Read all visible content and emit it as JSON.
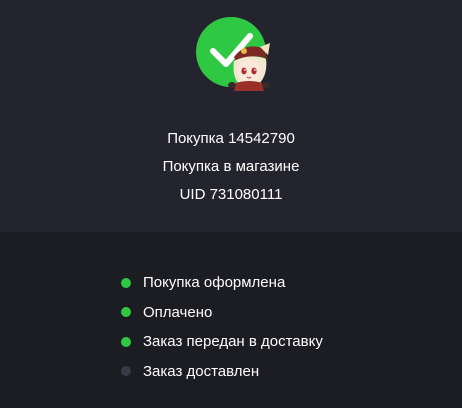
{
  "order": {
    "purchase_line": "Покупка 14542790",
    "type_line": "Покупка в магазине",
    "uid_line": "UID 731080111"
  },
  "colors": {
    "success_green": "#2fc843",
    "inactive_dot": "#3a3a46",
    "panel_top": "#24242e",
    "panel_bottom": "#1c1c23"
  },
  "icons": {
    "badge": "checkmark-icon",
    "mascot": "anime-chibi-character"
  },
  "statuses": [
    {
      "label": "Покупка оформлена",
      "done": true
    },
    {
      "label": "Оплачено",
      "done": true
    },
    {
      "label": "Заказ передан в доставку",
      "done": true
    },
    {
      "label": "Заказ доставлен",
      "done": false
    }
  ]
}
